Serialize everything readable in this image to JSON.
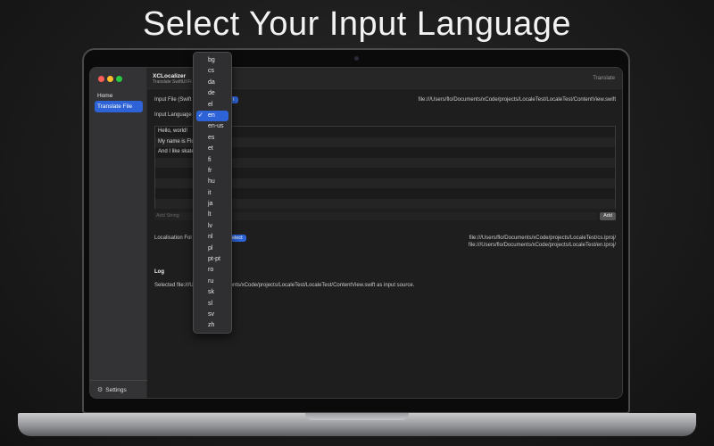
{
  "headline": "Select Your Input Language",
  "app": {
    "name": "XCLocalizer",
    "subtitle": "Translate SwiftUI Fi",
    "translate_label": "Translate"
  },
  "sidebar": {
    "items": [
      {
        "label": "Home",
        "active": false
      },
      {
        "label": "Translate File",
        "active": true
      }
    ],
    "settings_label": "Settings",
    "settings_icon": "gear-icon"
  },
  "main": {
    "input_file_label": "Input File (Swift",
    "select_button_label": "t",
    "input_file_path": "file:///Users/flo/Documents/xCode/projects/LocaleTest/LocaleTest/ContentView.swift",
    "input_language_label": "Input Language",
    "strings": [
      "Hello, world!",
      "My name is Flo",
      "And I like skate",
      "",
      "",
      "",
      "",
      ""
    ],
    "add_string_placeholder": "Add String",
    "add_button_label": "Add",
    "localisation_folder_label": "Localisation Fol",
    "localisation_select_label": "elect",
    "localisation_paths": [
      "file:///Users/flo/Documents/xCode/projects/LocaleTest/cs.lproj/",
      "file:///Users/flo/Documents/xCode/projects/LocaleTest/en.lproj/"
    ],
    "log_title": "Log",
    "log_line_prefix": "Selected file:///U",
    "log_line_suffix": "ents/xCode/projects/LocaleTest/LocaleTest/ContentView.swift as input source."
  },
  "language_menu": {
    "selected": "en",
    "options": [
      "bg",
      "cs",
      "da",
      "de",
      "el",
      "en",
      "en-us",
      "es",
      "et",
      "fi",
      "fr",
      "hu",
      "it",
      "ja",
      "lt",
      "lv",
      "nl",
      "pl",
      "pt-pt",
      "ro",
      "ru",
      "sk",
      "sl",
      "sv",
      "zh"
    ]
  },
  "colors": {
    "accent": "#2d63d6",
    "window_bg": "#1e1e1e",
    "sidebar_bg": "#333335"
  }
}
